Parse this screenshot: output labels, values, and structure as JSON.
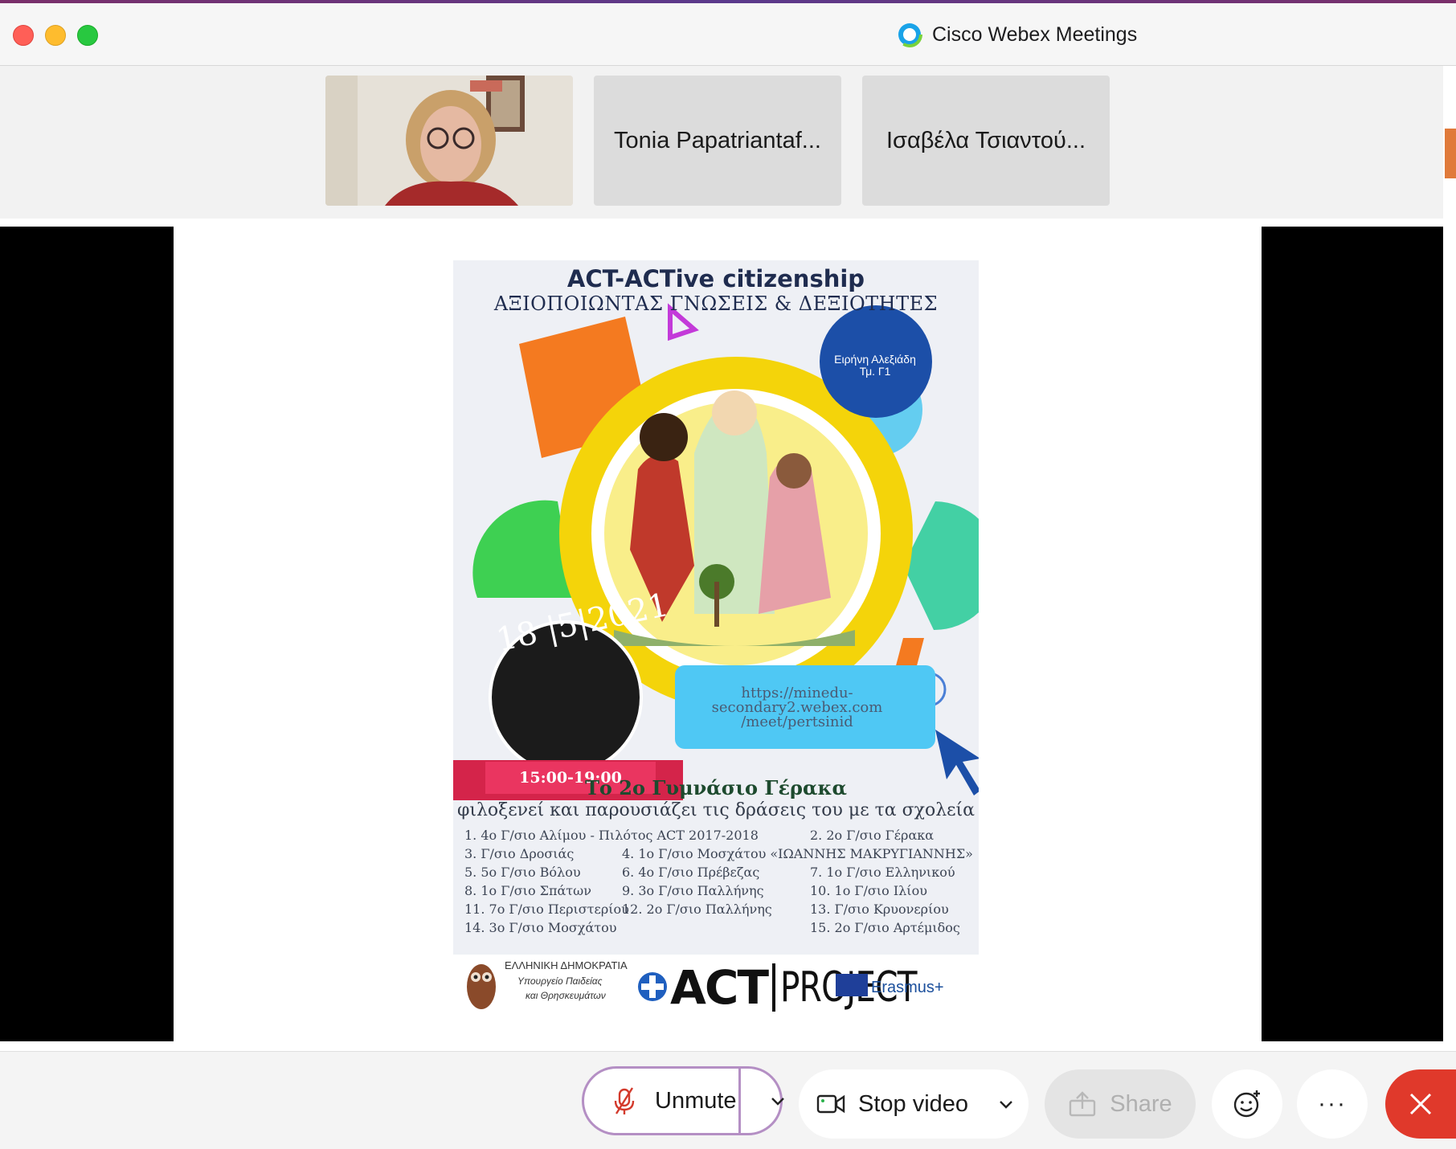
{
  "window": {
    "title": "Cisco Webex Meetings"
  },
  "participants": [
    {
      "name": "",
      "type": "video"
    },
    {
      "name": "Tonia Papatriantaf...",
      "type": "name"
    },
    {
      "name": "Ισαβέλα Τσιαντού...",
      "type": "name"
    }
  ],
  "poster": {
    "title": "ACT-ACTive citizenship",
    "subtitle": "ΑΞΙΟΠΟΙΩΝΤΑΣ ΓΝΩΣΕΙΣ & ΔΕΞΙΟΤΗΤΕΣ",
    "badge_line1": "Ειρήνη Αλεξιάδη",
    "badge_line2": "Τμ. Γ1",
    "date": "18 |5|2021",
    "time": "15:00-19:00",
    "url_line1": "https://minedu-",
    "url_line2": "secondary2.webex.com",
    "url_line3": "/meet/pertsinid",
    "school_title": "Το 2ο Γυμνάσιο Γέρακα",
    "school_subtitle": "φιλοξενεί και παρουσιάζει τις δράσεις του με τα σχολεία",
    "schools": [
      "1. 4ο Γ/σιο Αλίμου - Πιλότος ACT 2017-2018",
      "2. 2ο Γ/σιο Γέρακα",
      "3. Γ/σιο Δροσιάς",
      "4.  1ο Γ/σιο Μοσχάτου «ΙΩΑΝΝΗΣ ΜΑΚΡΥΓΙΑΝΝΗΣ»",
      "5.  5ο Γ/σιο Βόλου",
      "6.  4ο Γ/σιο Πρέβεζας",
      "7.  1ο Γ/σιο Ελληνικού",
      "8.  1ο Γ/σιο Σπάτων",
      "9.  3ο Γ/σιο Παλλήνης",
      "10.  1ο Γ/σιο Ιλίου",
      "11.  7ο Γ/σιο Περιστερίου",
      "12. 2ο Γ/σιο Παλλήνης",
      "13.  Γ/σιο Κρυονερίου",
      "14. 3ο Γ/σιο Μοσχάτου",
      "15.  2ο Γ/σιο Αρτέμιδος"
    ],
    "ministry_line1": "ΕΛΛΗΝΙΚΗ ΔΗΜΟΚΡΑΤΙΑ",
    "ministry_line2": "Υπουργείο Παιδείας",
    "ministry_line3": "και Θρησκευμάτων",
    "act_logo_left": "ACT",
    "act_logo_right": "PROJECT",
    "erasmus": "Erasmus+"
  },
  "toolbar": {
    "unmute_label": "Unmute",
    "stop_video_label": "Stop video",
    "share_label": "Share",
    "more_label": "···"
  },
  "colors": {
    "leave": "#e0392b",
    "focus_ring": "#b48fc4",
    "muted_icon": "#d33a2c"
  }
}
